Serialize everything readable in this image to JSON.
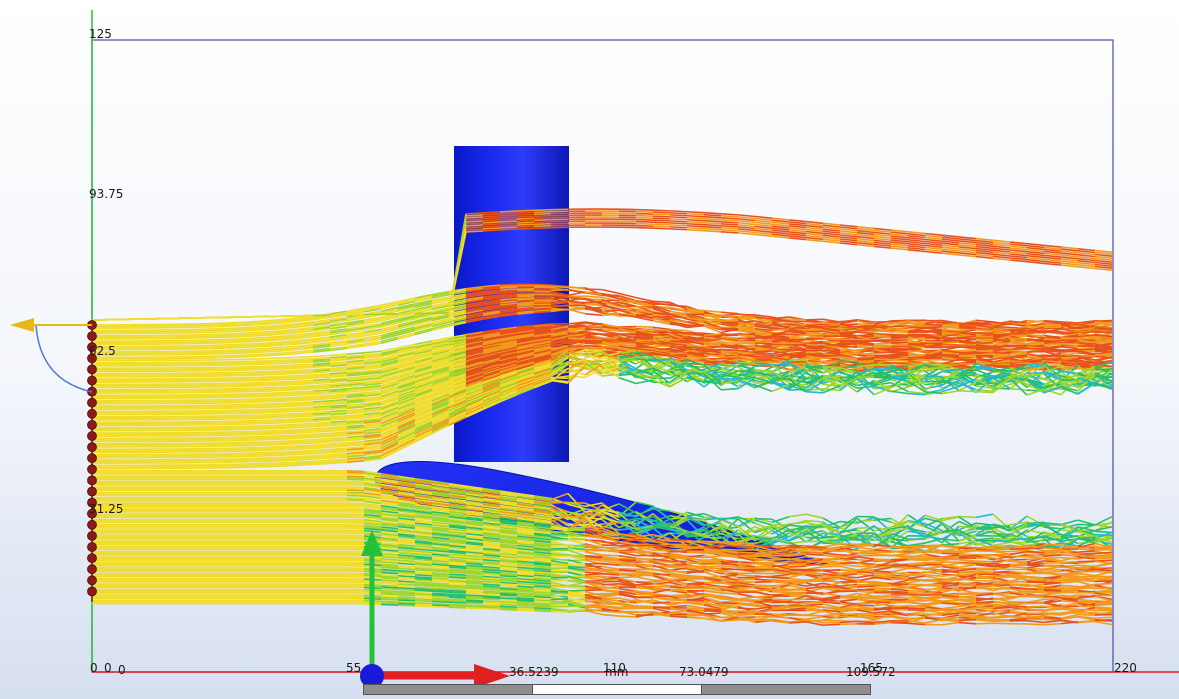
{
  "viewport": {
    "axis_ticks": {
      "y": [
        "125",
        "93.75",
        "62.5",
        "31.25",
        "0"
      ],
      "x": [
        "0",
        "55",
        "110",
        "165",
        "220"
      ]
    },
    "scale_bar": {
      "unit": "mm",
      "labels": [
        "0",
        "36.5239",
        "73.0479",
        "109.572"
      ]
    },
    "colors": {
      "geometry": "#1423ee",
      "streamline_palette": [
        "#2a56d8",
        "#22b8d8",
        "#27c06a",
        "#9fd62c",
        "#f0dc2a",
        "#f29a1c",
        "#e8521c"
      ],
      "x_axis": "#e02020",
      "y_axis": "#22c23a",
      "seed_points": "#8c1a1a"
    },
    "icons": [
      "coordinate-triad-icon",
      "streamline-seed-icon",
      "arrow-left-icon"
    ]
  }
}
